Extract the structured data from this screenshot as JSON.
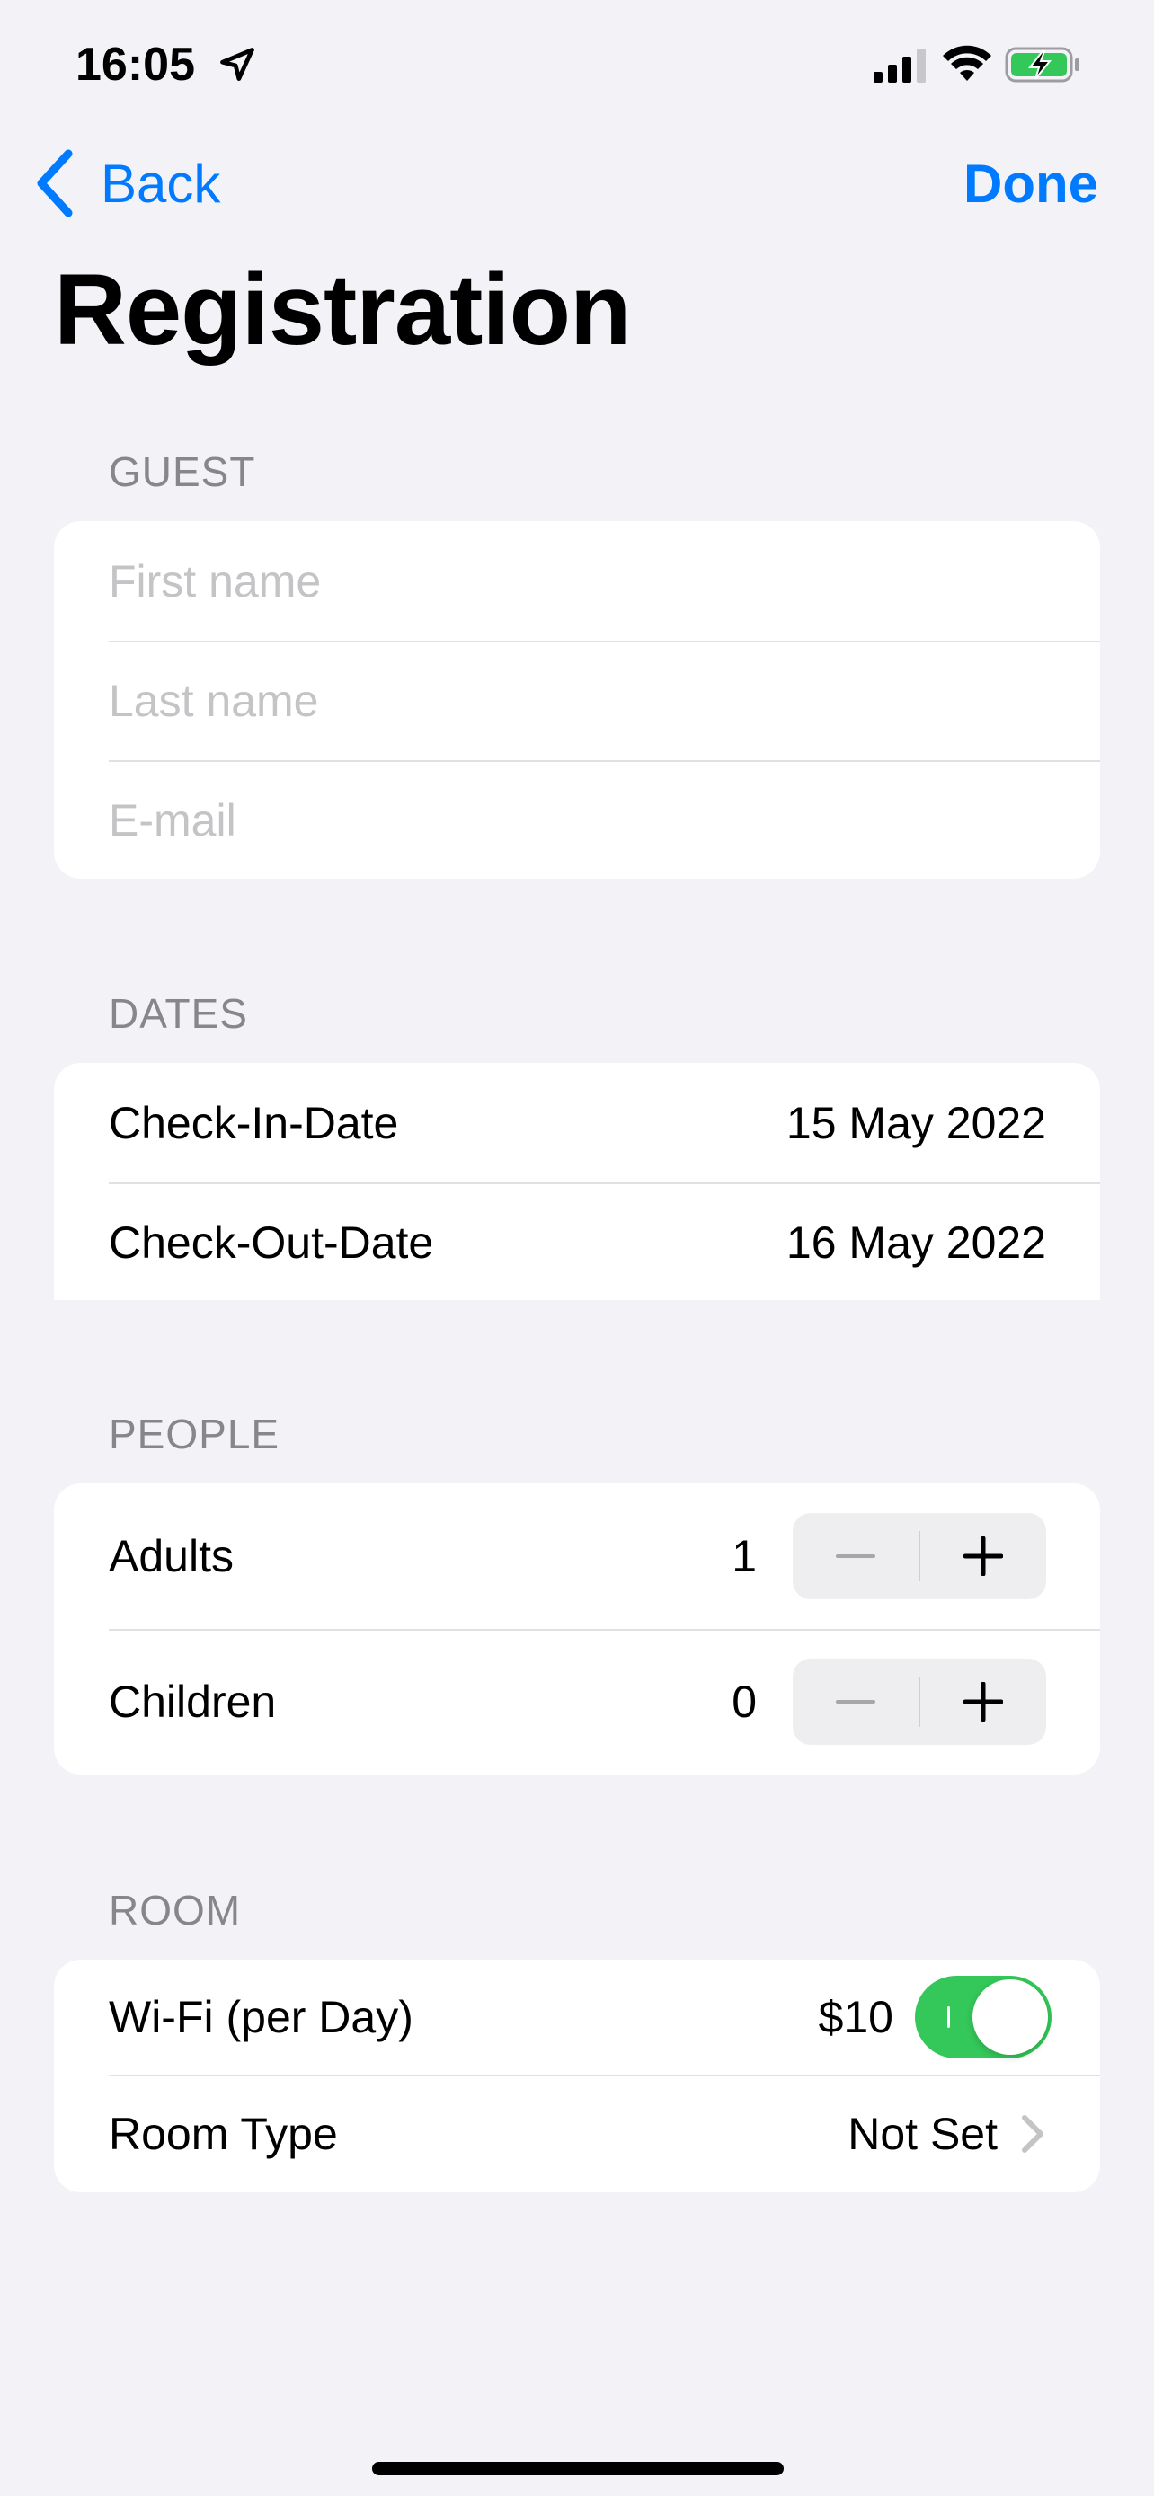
{
  "status_bar": {
    "time": "16:05",
    "location_icon": "location-arrow-icon",
    "signal_icon": "cellular-signal-icon",
    "wifi_icon": "wifi-icon",
    "battery_icon": "battery-charging-icon",
    "battery_color": "#34c759"
  },
  "nav": {
    "back_label": "Back",
    "done_label": "Done",
    "accent_color": "#007aff"
  },
  "page_title": "Registration",
  "guest": {
    "header": "GUEST",
    "first_name_placeholder": "First name",
    "last_name_placeholder": "Last name",
    "email_placeholder": "E-mail",
    "first_name_value": "",
    "last_name_value": "",
    "email_value": ""
  },
  "dates": {
    "header": "DATES",
    "check_in_label": "Check-In-Date",
    "check_in_value": "15 May 2022",
    "check_out_label": "Check-Out-Date",
    "check_out_value": "16 May 2022"
  },
  "people": {
    "header": "PEOPLE",
    "adults_label": "Adults",
    "adults_count": "1",
    "children_label": "Children",
    "children_count": "0",
    "stepper_icons": [
      "minus-icon",
      "plus-icon"
    ]
  },
  "room": {
    "header": "ROOM",
    "wifi_label": "Wi-Fi (per Day)",
    "wifi_price": "$10",
    "wifi_enabled": true,
    "toggle_color": "#34c759",
    "room_type_label": "Room Type",
    "room_type_value": "Not Set"
  }
}
